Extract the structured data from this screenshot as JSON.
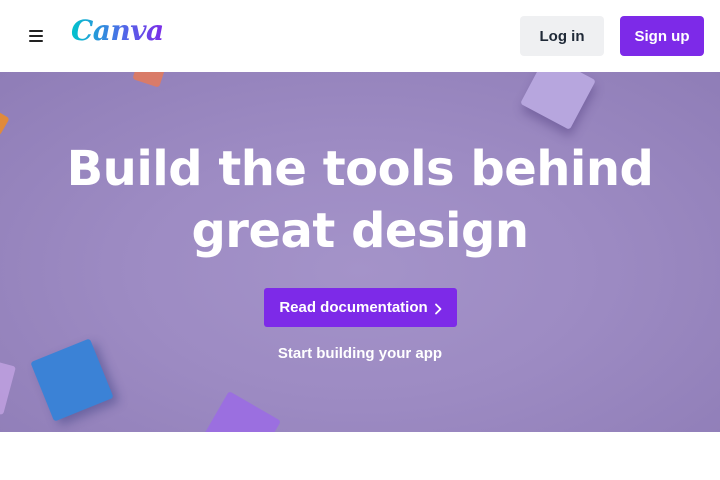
{
  "header": {
    "menu_icon": "hamburger-icon",
    "logo_text": "Canva",
    "login_label": "Log in",
    "signup_label": "Sign up",
    "brand_color": "#7d2ae8"
  },
  "hero": {
    "title": "Build the tools behind great design",
    "cta_label": "Read documentation",
    "cta_icon": "chevron-right-icon",
    "sub_link": "Start building your app",
    "background_color": "#9d8bc3"
  }
}
